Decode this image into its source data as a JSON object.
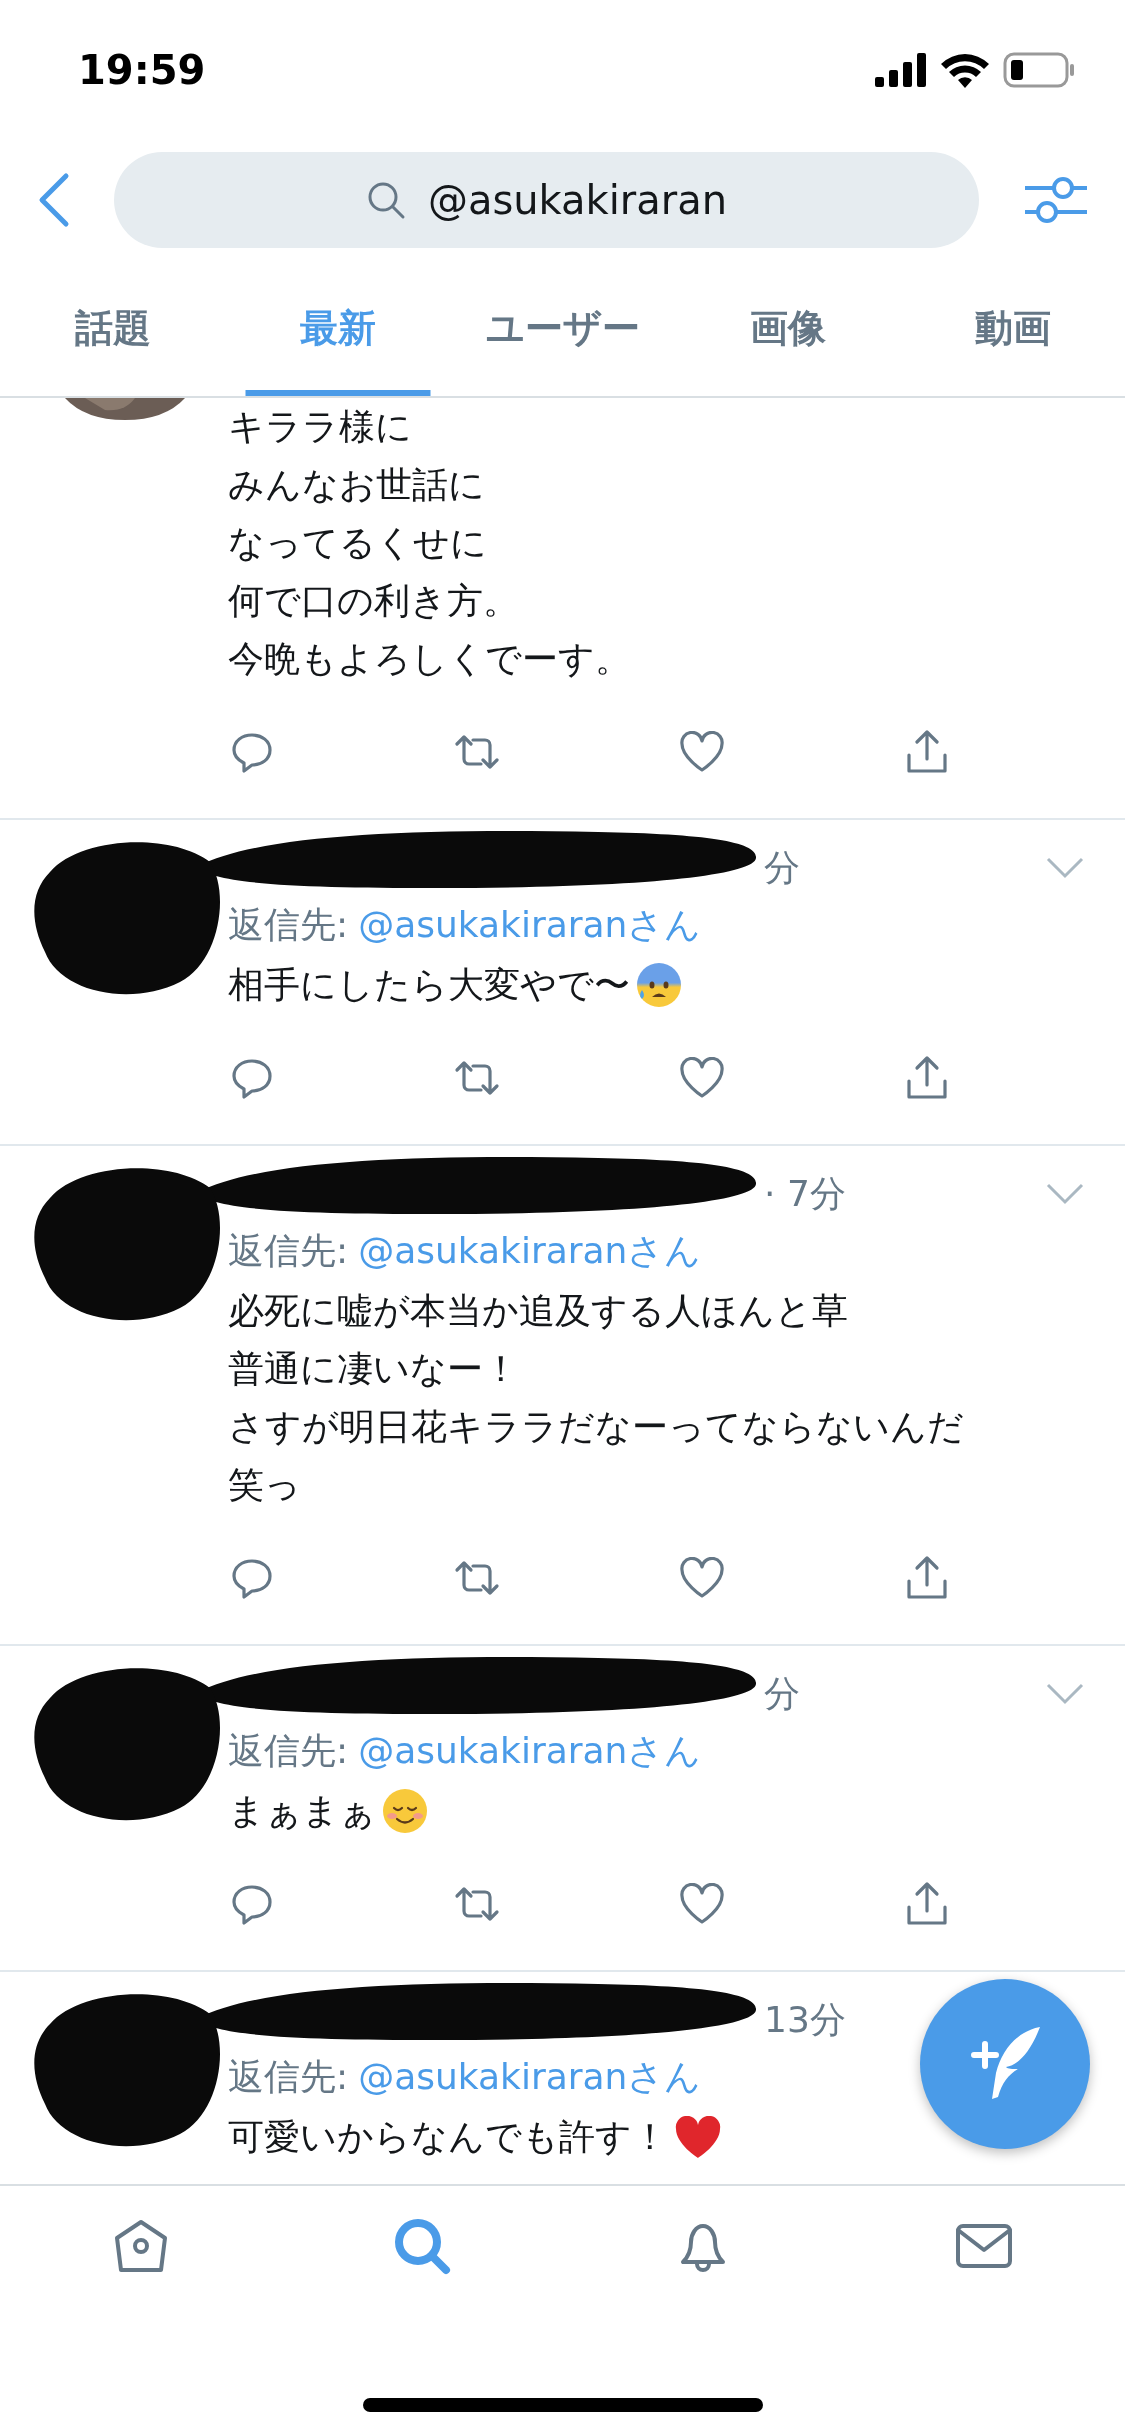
{
  "status_bar": {
    "time": "19:59"
  },
  "search": {
    "value": "@asukakiraran"
  },
  "tabs": [
    {
      "label": "話題",
      "selected": false
    },
    {
      "label": "最新",
      "selected": true
    },
    {
      "label": "ユーザー",
      "selected": false
    },
    {
      "label": "画像",
      "selected": false
    },
    {
      "label": "動画",
      "selected": false
    }
  ],
  "tweets": [
    {
      "kind": "partial",
      "text": [
        "キララ様に",
        "みんなお世話に",
        "なってるくせに",
        "何で口の利き方。",
        "今晩もよろしくでーす。"
      ]
    },
    {
      "kind": "reply",
      "header_visible": "分",
      "reply_label": "返信先:",
      "reply_to": "@asukakiraranさん",
      "text": [
        "相手にしたら大変やで〜"
      ],
      "emoji": {
        "kind": "anxious"
      }
    },
    {
      "kind": "reply",
      "header_visible": "· 7分",
      "reply_label": "返信先:",
      "reply_to": "@asukakiraranさん",
      "text": [
        "必死に嘘が本当か追及する人ほんと草",
        "普通に凄いなー！",
        "さすが明日花キララだなーってならないんだ",
        "笑っ"
      ]
    },
    {
      "kind": "reply",
      "header_visible": "分",
      "reply_label": "返信先:",
      "reply_to": "@asukakiraranさん",
      "text": [
        "まぁまぁ"
      ],
      "emoji": {
        "kind": "smiling"
      }
    },
    {
      "kind": "reply_cut",
      "header_visible": "13分",
      "reply_label": "返信先:",
      "reply_to": "@asukakiraranさん",
      "text": [
        "可愛いからなんでも許す！"
      ],
      "emoji": {
        "kind": "heart"
      }
    }
  ],
  "bottom_nav": [
    {
      "kind": "home",
      "selected": false
    },
    {
      "kind": "search",
      "selected": true
    },
    {
      "kind": "notifications",
      "selected": false
    },
    {
      "kind": "messages",
      "selected": false
    }
  ]
}
